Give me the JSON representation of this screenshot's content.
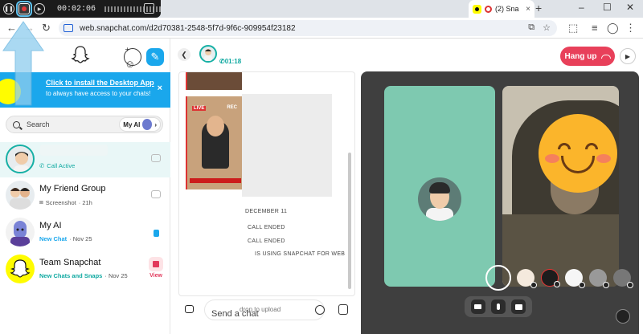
{
  "recorder": {
    "pause_label": "Pause recording",
    "stop_label": "Stop recording",
    "play_label": "Resume",
    "time": "00:02:06",
    "exit_label": "Exit"
  },
  "browser": {
    "tab_title": "(2) Sna",
    "tab_close": "×",
    "new_tab": "+",
    "url": "web.snapchat.com/d2d70381-2548-5f7d-9f6c-909954f23182",
    "back": "←",
    "forward": "→",
    "reload": "↻",
    "minimize": "–",
    "maximize": "☐",
    "close": "✕"
  },
  "sidebar": {
    "install_title": "Click to install the Desktop App",
    "install_sub": "to always have access to your chats!",
    "install_close": "×",
    "search_placeholder": "Search",
    "myai_pill": "My AI",
    "chats": [
      {
        "name": "",
        "status": "Call Active"
      },
      {
        "name": "My Friend Group",
        "status": "Screenshot",
        "time": "· 21h"
      },
      {
        "name": "My AI",
        "status": "New Chat",
        "time": "· Nov 25"
      },
      {
        "name": "Team Snapchat",
        "status": "New Chats and Snaps",
        "time": "· Nov 25",
        "action": "View"
      }
    ]
  },
  "conversation": {
    "call_duration": "01:18",
    "thumb_live": "LIVE",
    "thumb_rec": "REC",
    "date_divider": "DECEMBER 11",
    "events": [
      "CALL ENDED",
      "CALL ENDED",
      "IS USING SNAPCHAT FOR WEB"
    ],
    "compose_placeholder": "Send a chat",
    "compose_drop": "drop to upload"
  },
  "call": {
    "hangup_label": "Hang up"
  },
  "colors": {
    "snap_yellow": "#fffc00",
    "accent_blue": "#1aa7ec",
    "hangup_red": "#e8405a",
    "teal": "#10a9a1"
  }
}
